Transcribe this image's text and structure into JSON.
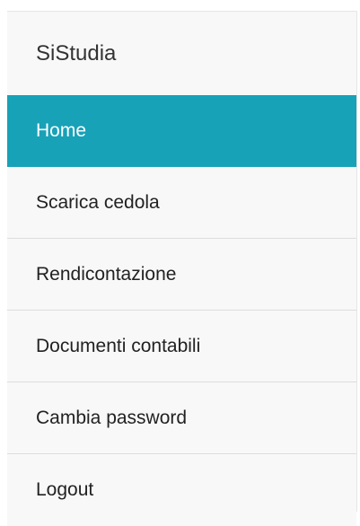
{
  "brand": {
    "name": "SiStudia"
  },
  "nav": {
    "items": [
      {
        "label": "Home",
        "active": true
      },
      {
        "label": "Scarica cedola",
        "active": false
      },
      {
        "label": "Rendicontazione",
        "active": false
      },
      {
        "label": "Documenti contabili",
        "active": false
      },
      {
        "label": "Cambia password",
        "active": false
      },
      {
        "label": "Logout",
        "active": false
      }
    ]
  },
  "colors": {
    "active_background": "#17a2b8",
    "sidebar_background": "#f8f8f8",
    "divider": "#dddddd"
  }
}
